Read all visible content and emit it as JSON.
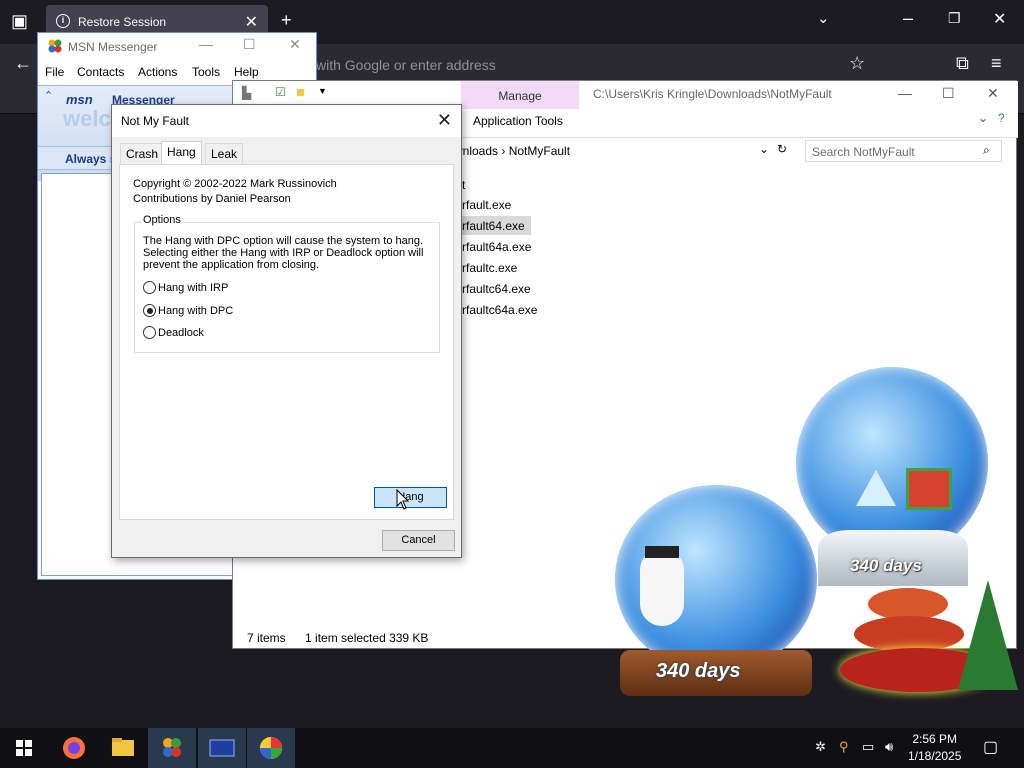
{
  "browser": {
    "tab_title": "Restore Session",
    "url_placeholder": "with Google or enter address",
    "new_tab": "+",
    "tab_close": "✕"
  },
  "msn": {
    "title": "MSN Messenger",
    "menu": [
      "File",
      "Contacts",
      "Actions",
      "Tools",
      "Help"
    ],
    "brand": "msn",
    "brand_sub": "Messenger",
    "welcome": "welc",
    "always": "Always s"
  },
  "explorer": {
    "manage_tab": "Manage",
    "app_tools": "Application Tools",
    "path": "C:\\Users\\Kris Kringle\\Downloads\\NotMyFault",
    "breadcrumb": "wnloads  ›  NotMyFault",
    "search_placeholder": "Search NotMyFault",
    "header_fragment": "t",
    "files": [
      {
        "name": "rfault.exe",
        "selected": false
      },
      {
        "name": "rfault64.exe",
        "selected": true
      },
      {
        "name": "rfault64a.exe",
        "selected": false
      },
      {
        "name": "rfaultc.exe",
        "selected": false
      },
      {
        "name": "rfaultc64.exe",
        "selected": false
      },
      {
        "name": "rfaultc64a.exe",
        "selected": false
      }
    ],
    "status_items": "7 items",
    "status_selected": "1 item selected  339 KB"
  },
  "desktop": {
    "globe_small_days": "340 days",
    "globe_big_days": "340 days"
  },
  "dialog": {
    "title": "Not My Fault",
    "tabs": [
      "Crash",
      "Hang",
      "Leak"
    ],
    "active_tab": "Hang",
    "copyright": "Copyright © 2002-2022 Mark Russinovich",
    "contributions": "Contributions by Daniel Pearson",
    "options_legend": "Options",
    "options_desc": "The Hang with DPC option will cause the system to hang. Selecting either the Hang with IRP or Deadlock option will prevent the application from closing.",
    "radio_options": [
      {
        "label": "Hang with IRP",
        "checked": false
      },
      {
        "label": "Hang with DPC",
        "checked": true
      },
      {
        "label": "Deadlock",
        "checked": false
      }
    ],
    "hang_button": "Hang",
    "cancel_button": "Cancel"
  },
  "taskbar": {
    "time": "2:56 PM",
    "date": "1/18/2025"
  }
}
